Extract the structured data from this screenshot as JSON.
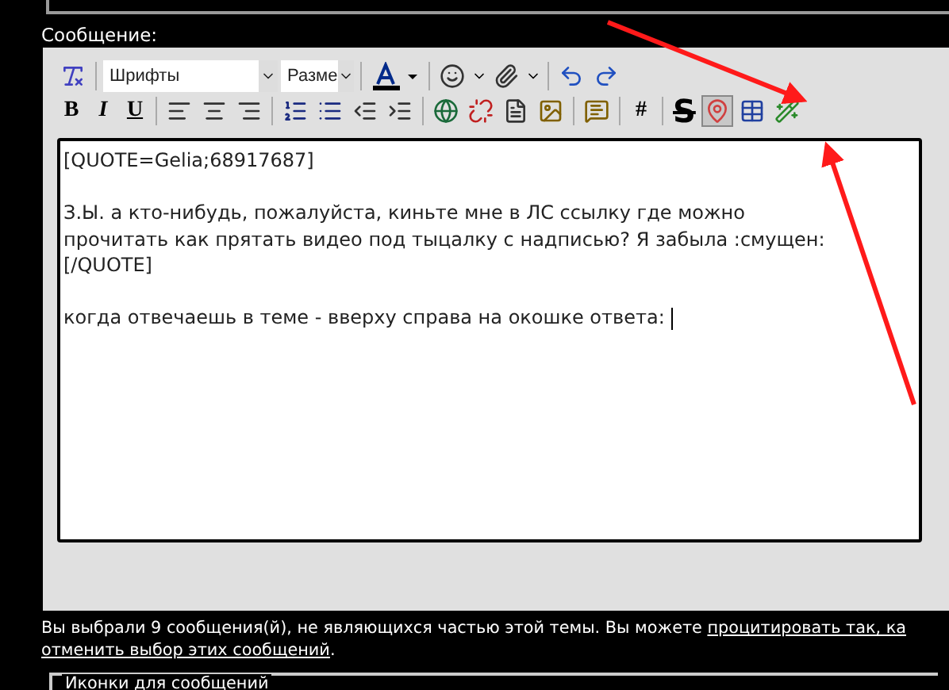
{
  "section_label": "Сообщение:",
  "toolbar": {
    "font_select": "Шрифты",
    "size_select": "Разме",
    "format_buttons": [
      "B",
      "I",
      "U"
    ],
    "code_button": "#",
    "strike_button": "S",
    "map_button": {
      "pressed": true
    }
  },
  "editor": {
    "paragraphs": [
      [
        "[QUOTE=Gelia;68917687]"
      ],
      [
        "З.Ы. а кто-нибудь, пожалуйста, киньте мне в ЛС ссылку где можно",
        "прочитать как прятать видео под тыцалку с надписью? Я забыла :смущен:",
        "[/QUOTE]"
      ],
      [
        "когда отвечаешь в теме - вверху справа на окошке ответа: "
      ]
    ]
  },
  "notice": {
    "text": "Вы выбрали 9 сообщения(й), не являющихся частью этой темы. Вы можете ",
    "quote_link": "процитировать так, ка",
    "cancel_link": "отменить выбор этих сообщений",
    "end": "."
  },
  "icons_fieldset": {
    "legend": "Иконки для сообщений"
  }
}
